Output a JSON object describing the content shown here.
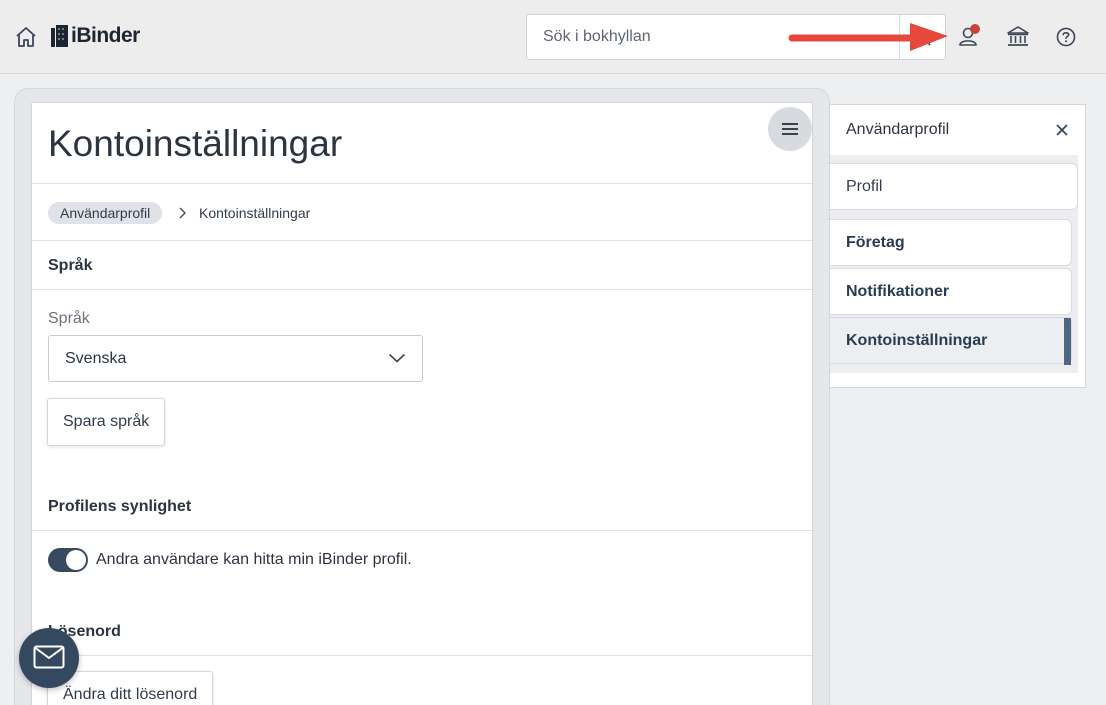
{
  "header": {
    "logo_text": "iBinder",
    "search": {
      "placeholder": "Sök i bokhyllan"
    },
    "notification_color": "#c8443a",
    "annotation_arrow_color": "#e8483c"
  },
  "page": {
    "title": "Kontoinställningar",
    "breadcrumb": {
      "parent": "Användarprofil",
      "current": "Kontoinställningar"
    },
    "language_section": {
      "heading": "Språk",
      "field_label": "Språk",
      "selected": "Svenska",
      "save_button": "Spara språk"
    },
    "visibility_section": {
      "heading": "Profilens synlighet",
      "toggle_label": "Andra användare kan hitta min iBinder profil.",
      "toggle_on": true
    },
    "password_section": {
      "heading": "Lösenord",
      "change_button": "Ändra ditt lösenord"
    }
  },
  "sidebar": {
    "title": "Användarprofil",
    "items": [
      {
        "label": "Profil"
      },
      {
        "label": "Företag"
      },
      {
        "label": "Notifikationer"
      },
      {
        "label": "Kontoinställningar"
      }
    ],
    "active_index": 3,
    "accent_color": "#506781"
  },
  "icons": {
    "home": "home-icon",
    "search": "search-icon",
    "user": "user-icon",
    "institution": "bank-icon",
    "help": "help-icon",
    "menu": "hamburger-icon",
    "close": "close-icon",
    "mail": "mail-icon"
  }
}
